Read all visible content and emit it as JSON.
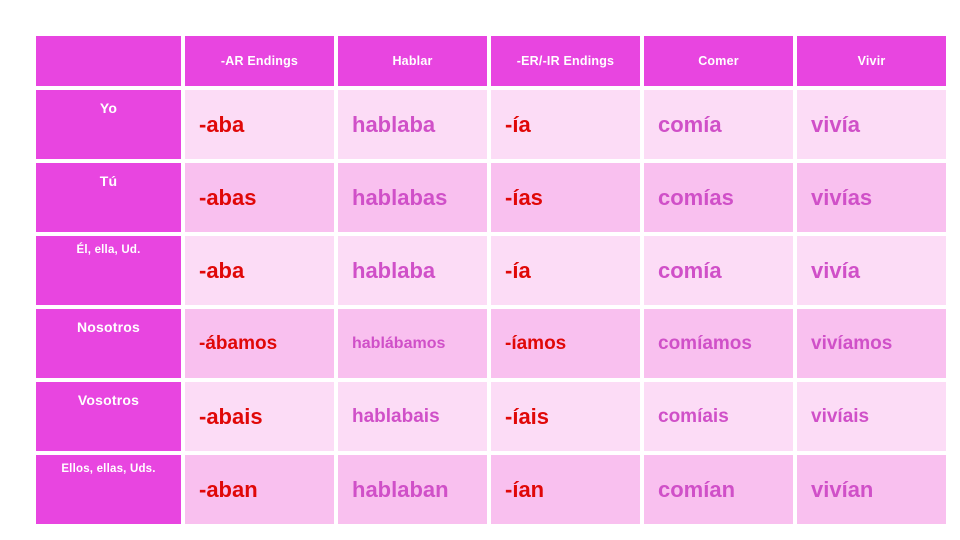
{
  "table": {
    "corner_label": "",
    "columns": [
      {
        "key": "person",
        "label": ""
      },
      {
        "key": "ar_endings",
        "label": "-AR Endings"
      },
      {
        "key": "hablar",
        "label": "Hablar"
      },
      {
        "key": "er_ir_endings",
        "label": "-ER/-IR Endings"
      },
      {
        "key": "comer",
        "label": "Comer"
      },
      {
        "key": "vivir",
        "label": "Vivir"
      }
    ],
    "rows": [
      {
        "person": "Yo",
        "ar_endings": "-aba",
        "hablar": "hablaba",
        "er_ir_endings": "-ía",
        "comer": "comía",
        "vivir": "vivía"
      },
      {
        "person": "Tú",
        "ar_endings": "-abas",
        "hablar": "hablabas",
        "er_ir_endings": "-ías",
        "comer": "comías",
        "vivir": "vivías"
      },
      {
        "person": "Él, ella, Ud.",
        "ar_endings": "-aba",
        "hablar": "hablaba",
        "er_ir_endings": "-ía",
        "comer": "comía",
        "vivir": "vivía"
      },
      {
        "person": "Nosotros",
        "ar_endings": "-ábamos",
        "hablar": "hablábamos",
        "er_ir_endings": "-íamos",
        "comer": "comíamos",
        "vivir": "vivíamos"
      },
      {
        "person": "Vosotros",
        "ar_endings": "-abais",
        "hablar": "hablabais",
        "er_ir_endings": "-íais",
        "comer": "comíais",
        "vivir": "vivíais"
      },
      {
        "person": "Ellos, ellas, Uds.",
        "ar_endings": "-aban",
        "hablar": "hablaban",
        "er_ir_endings": "-ían",
        "comer": "comían",
        "vivir": "vivían"
      }
    ]
  },
  "colors": {
    "header_background": "#e845e0",
    "person_background": "#e845e0",
    "row_light_background": "#fcdcf6",
    "row_dark_background": "#f9c0ef",
    "ending_text": "#e00808",
    "verb_text": "#d050c8",
    "header_text": "#ffffff",
    "page_background": "#ffffff",
    "gridline": "#ffffff"
  }
}
